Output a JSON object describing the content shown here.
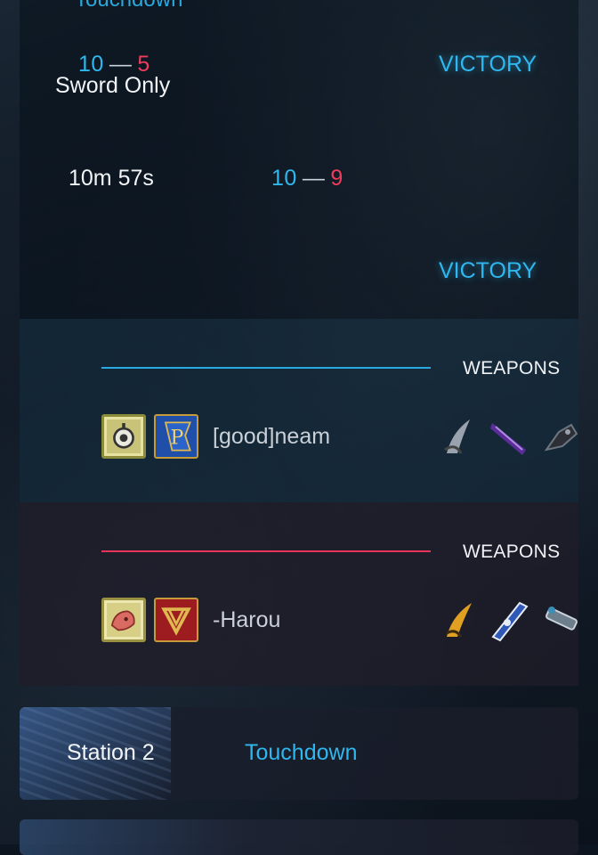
{
  "top_cut_text": "Touchdown",
  "summary": {
    "match1": {
      "score_blue": "10",
      "score_red": "5",
      "dash": "—",
      "mode": "Sword Only",
      "result": "VICTORY"
    },
    "match2": {
      "duration": "10m 57s",
      "score_blue": "10",
      "score_red": "9",
      "dash": "—"
    },
    "match3": {
      "result": "VICTORY"
    }
  },
  "teams": [
    {
      "side": "blue",
      "weapons_label": "WEAPONS",
      "player": {
        "name": "[good]neam",
        "emblem_icon": "target-emblem-icon",
        "banner_icon": "blue-banner-icon"
      },
      "weapons": [
        "claw-blade-icon",
        "purple-blade-icon",
        "gauntlet-icon"
      ]
    },
    {
      "side": "red",
      "weapons_label": "WEAPONS",
      "player": {
        "name": "-Harou",
        "emblem_icon": "beast-emblem-icon",
        "banner_icon": "red-banner-icon"
      },
      "weapons": [
        "gold-claw-icon",
        "blue-greatsword-icon",
        "cannon-icon"
      ]
    }
  ],
  "map_card": {
    "map_name": "Station 2",
    "mode": "Touchdown"
  },
  "colors": {
    "blue": "#2fb7ef",
    "red": "#f03c5c",
    "background": "#0d1520"
  }
}
